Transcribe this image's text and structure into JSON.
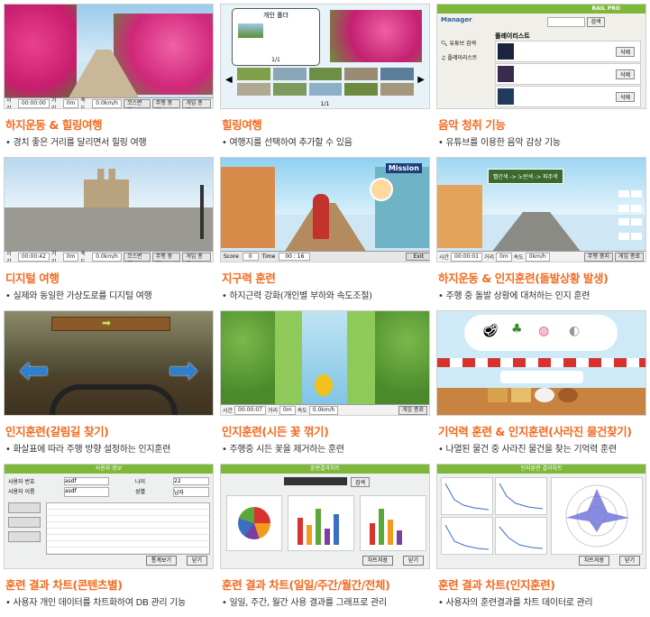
{
  "cards": [
    {
      "title": "하지운동 & 힐링여행",
      "desc": "경치 좋은 거리를 달리면서 힐링 여행",
      "hud": {
        "time_label": "시간",
        "time_value": "00:00:00",
        "dist_label": "거리",
        "dist_value": "0m",
        "speed_label": "속도",
        "speed_value": "0.0km/h",
        "btn1": "코스변경",
        "btn2": "주행 중지",
        "btn3": "게임 종료"
      }
    },
    {
      "title": "힐링여행",
      "desc": "여행지를 선택하여 추가할 수 있음",
      "folder_title": "개인 폴더",
      "page_top": "1/1",
      "page_bottom": "1/1"
    },
    {
      "title": "음악 청취 기능",
      "desc": "유튜브를 이용한 음악 감상 기능",
      "app_name": "Manager",
      "brand": "RAIL PRO",
      "search_btn": "검색",
      "youtube_search": "유튜브 검색",
      "playlist_label": "플레이리스트",
      "playlist_header": "플레이리스트",
      "delete_btn": "삭제"
    },
    {
      "title": "디지털 여행",
      "desc": "실제와 동일한 가상도로를 디지털 여행",
      "hud": {
        "time_label": "시간",
        "time_value": "00:00:42",
        "dist_label": "거리",
        "dist_value": "0m",
        "speed_label": "속도",
        "speed_value": "0.0km/h",
        "btn1": "코스변경",
        "btn2": "주행 중지",
        "btn3": "게임 종료"
      }
    },
    {
      "title": "지구력 훈련",
      "desc": "하지근력 강화(개인별 부하와 속도조절)",
      "mission": "Mission",
      "score_label": "Score",
      "score_value": "0",
      "time_label": "Time",
      "time_value": "00 : 16",
      "exit": "Exit"
    },
    {
      "title": "하지운동 & 인지훈련(돌발상황 발생)",
      "desc": "주행 중 돌발 상황에 대처하는 인지 훈련",
      "sign": "빨간색 -> 노란색 -> 파주색",
      "hud": {
        "time_label": "시간",
        "time_value": "00:00:01",
        "dist_label": "거리",
        "dist_value": "0m",
        "speed_label": "속도",
        "speed_value": "0km/h",
        "btn1": "",
        "btn2": "주행 중지",
        "btn3": "게임 종료"
      }
    },
    {
      "title": "인지훈련(갈림길 찾기)",
      "desc": "화살표에 따라 주행 방향 설정하는 인지훈련"
    },
    {
      "title": "인지훈련(시든 꽃 꺾기)",
      "desc": "주행중 시든 꽃을 제거하는 훈련",
      "hud": {
        "time_label": "시간",
        "time_value": "00:00:07",
        "dist_label": "거리",
        "dist_value": "0m",
        "speed_label": "속도",
        "speed_value": "0.0km/h",
        "btn1": "",
        "btn2": "",
        "btn3": "게임 종료"
      }
    },
    {
      "title": "기억력 훈련 & 인지훈련(사라진 물건찾기)",
      "desc": "나열된 물건 중 사라진 물건을 찾는 기억력 훈련"
    },
    {
      "title": "훈련 결과 차트(콘텐츠별)",
      "desc": "사용자 개인 데이터를 차트화하여 DB 관리 기능",
      "window_title": "사용자 정보",
      "id_label": "사용자 번호",
      "name_label": "사용자 이름",
      "id_value": "asdf",
      "name_value": "asdf",
      "age_label": "나이",
      "age_value": "22",
      "gender_label": "성별",
      "gender_value": "남자",
      "btn_chart": "통계보기",
      "btn_close": "닫기"
    },
    {
      "title": "훈련 결과 차트(일일/주간/월간/전체)",
      "desc": "일일, 주간, 월간 사용 결과를 그래프로 관리",
      "window_title": "훈련결과차트",
      "search_btn": "검색",
      "btn_save": "차트저장",
      "btn_close": "닫기"
    },
    {
      "title": "훈련 결과 차트(인지훈련)",
      "desc": "사용자의 훈련결과를 차트 데이터로 관리",
      "window_title": "인지훈련 결과차트",
      "btn_save": "차트저장",
      "btn_close": "닫기"
    }
  ],
  "colors": {
    "title": "#f26b21",
    "accent_green": "#7db83a",
    "sky": "#a8d4f2"
  }
}
